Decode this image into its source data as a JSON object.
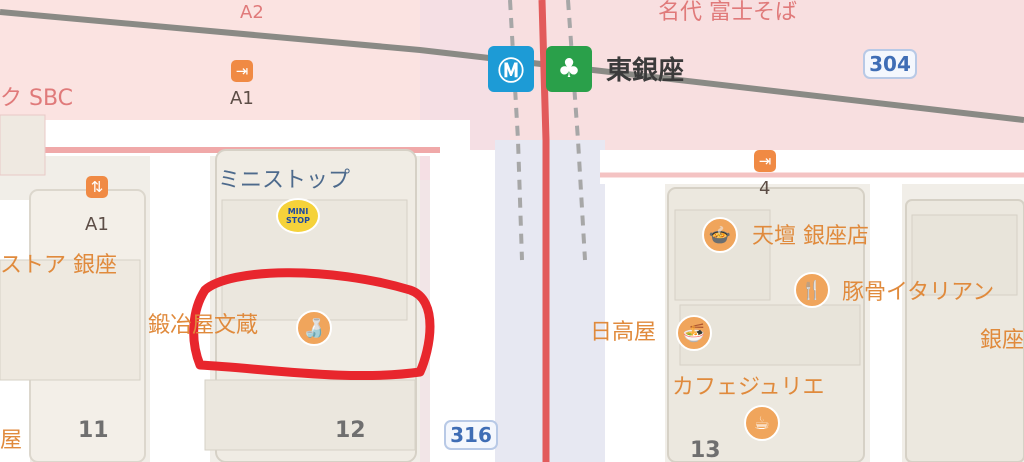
{
  "map": {
    "station": {
      "name": "東銀座",
      "icons": [
        "tokyo-metro-icon",
        "toei-subway-icon"
      ],
      "metro_color": "#1d9bd6",
      "toei_color": "#2aa04a"
    },
    "exits": [
      "A2",
      "A1",
      "A1",
      "4"
    ],
    "road_routes": [
      "304",
      "316"
    ],
    "places": [
      {
        "name": "ミニストップ",
        "icon": "convenience-store-icon"
      },
      {
        "name": "鍛冶屋文蔵",
        "icon": "izakaya-icon"
      },
      {
        "name": "天壇 銀座店",
        "icon": "restaurant-icon"
      },
      {
        "name": "豚骨イタリアン",
        "icon": "restaurant-icon"
      },
      {
        "name": "日高屋",
        "icon": "ramen-icon"
      },
      {
        "name": "カフェジュリエ",
        "icon": "cafe-icon"
      }
    ],
    "partial_labels": {
      "top_right": "名代 富士そば",
      "left_pink": "ク SBC",
      "left_store": "ストア 銀座",
      "bottom_left": "屋",
      "right_ginza": "銀座"
    },
    "block_numbers": [
      "11",
      "12",
      "13"
    ],
    "ministop_badge": "MINI STOP",
    "annotation": {
      "shape": "hand-drawn circle",
      "color": "#e8262d",
      "target": "鍛冶屋文蔵"
    },
    "colors": {
      "background": "#f1eee8",
      "rail_line": "#e25b5b",
      "route_shield": "#3f6db5"
    }
  }
}
